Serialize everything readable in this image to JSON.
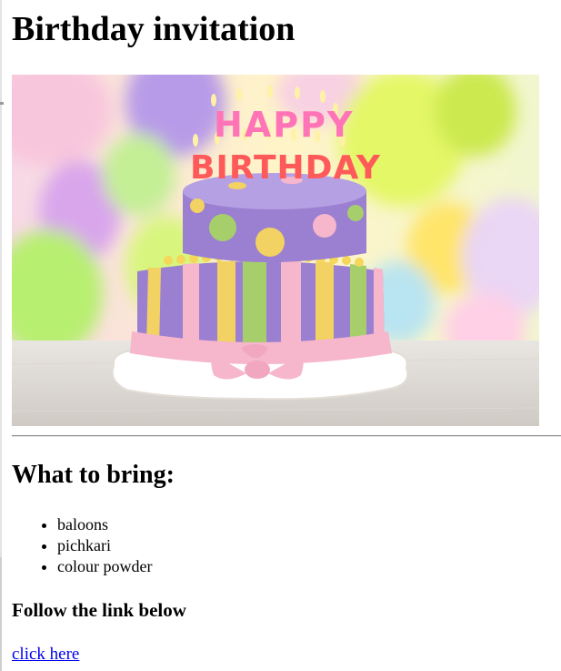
{
  "page": {
    "title": "Birthday invitation"
  },
  "hero_image": {
    "cake_text_line1": "HAPPY",
    "cake_text_line2": "BIRTHDAY"
  },
  "bring_section": {
    "heading": "What to bring:",
    "items": [
      "baloons",
      "pichkari",
      "colour powder"
    ]
  },
  "follow": {
    "heading": "Follow the link below",
    "link_text": "click here"
  },
  "colors": {
    "link": "#0000ee",
    "cake_purple": "#9b7fd0",
    "cake_pink": "#f6b6cc",
    "cake_yellow": "#f2d262",
    "cake_green": "#a6cf6c"
  }
}
